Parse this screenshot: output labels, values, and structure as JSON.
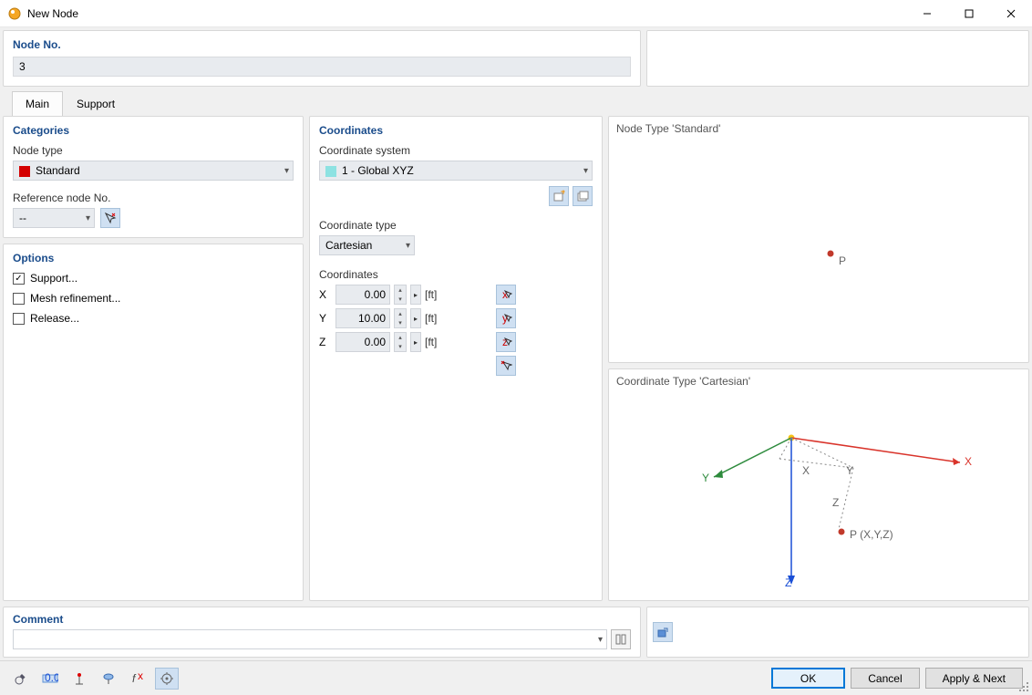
{
  "window": {
    "title": "New Node"
  },
  "node_no": {
    "label": "Node No.",
    "value": "3"
  },
  "tabs": {
    "main": "Main",
    "support": "Support",
    "active": "main"
  },
  "categories": {
    "header": "Categories",
    "node_type_label": "Node type",
    "node_type_value": "Standard",
    "ref_node_label": "Reference node No.",
    "ref_node_value": "--"
  },
  "options": {
    "header": "Options",
    "support": {
      "label": "Support...",
      "checked": true
    },
    "mesh": {
      "label": "Mesh refinement...",
      "checked": false
    },
    "release": {
      "label": "Release...",
      "checked": false
    }
  },
  "coordinates": {
    "header": "Coordinates",
    "system_label": "Coordinate system",
    "system_value": "1 - Global XYZ",
    "type_label": "Coordinate type",
    "type_value": "Cartesian",
    "coords_label": "Coordinates",
    "x": {
      "label": "X",
      "value": "0.00",
      "unit": "[ft]"
    },
    "y": {
      "label": "Y",
      "value": "10.00",
      "unit": "[ft]"
    },
    "z": {
      "label": "Z",
      "value": "0.00",
      "unit": "[ft]"
    }
  },
  "preview": {
    "node_type_caption": "Node Type 'Standard'",
    "coord_type_caption": "Coordinate Type 'Cartesian'",
    "point_label": "P",
    "axes": {
      "x": "X",
      "y": "Y",
      "z": "Z",
      "point": "P (X,Y,Z)"
    }
  },
  "comment": {
    "header": "Comment",
    "value": ""
  },
  "footer": {
    "ok": "OK",
    "cancel": "Cancel",
    "apply_next": "Apply & Next"
  }
}
